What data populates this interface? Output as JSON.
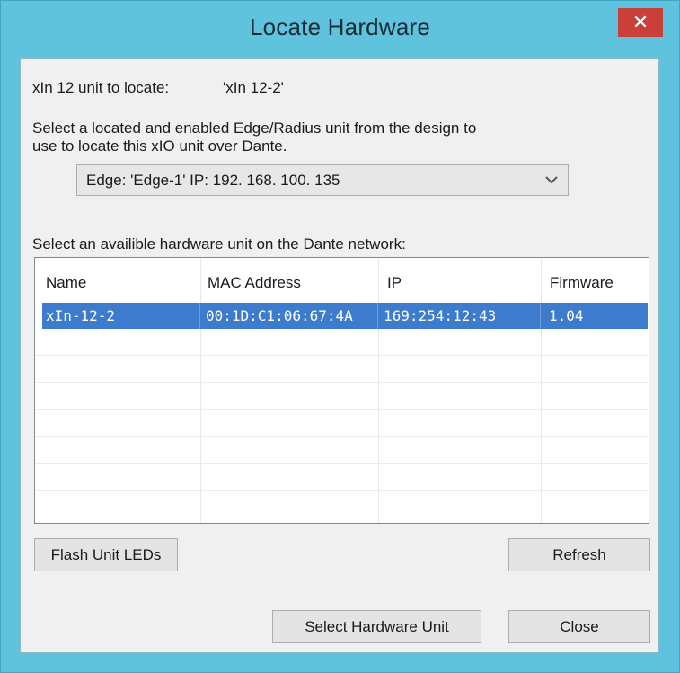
{
  "window": {
    "title": "Locate Hardware",
    "close_glyph": "✕"
  },
  "unit": {
    "label": "xIn 12 unit to locate:",
    "value": "'xIn 12-2'"
  },
  "instruction": {
    "line1": "Select a located and enabled Edge/Radius unit from the design to",
    "line2": "use to locate this xIO unit over Dante."
  },
  "combo": {
    "selected": "Edge: 'Edge-1' IP: 192. 168. 100. 135",
    "arrow_icon": "chevron-down-icon"
  },
  "list": {
    "label": "Select an availible hardware unit on the Dante network:",
    "columns": [
      "Name",
      "MAC Address",
      "IP",
      "Firmware"
    ],
    "rows": [
      {
        "name": "xIn-12-2",
        "mac": "00:1D:C1:06:67:4A",
        "ip": "169:254:12:43",
        "firmware": "1.04",
        "selected": true
      }
    ]
  },
  "buttons": {
    "flash": "Flash Unit LEDs",
    "refresh": "Refresh",
    "select": "Select Hardware Unit",
    "close": "Close"
  },
  "colors": {
    "frame": "#5fc3dd",
    "close_button": "#c9403a",
    "selection": "#3d7ccc",
    "client_bg": "#f0f0f0"
  }
}
